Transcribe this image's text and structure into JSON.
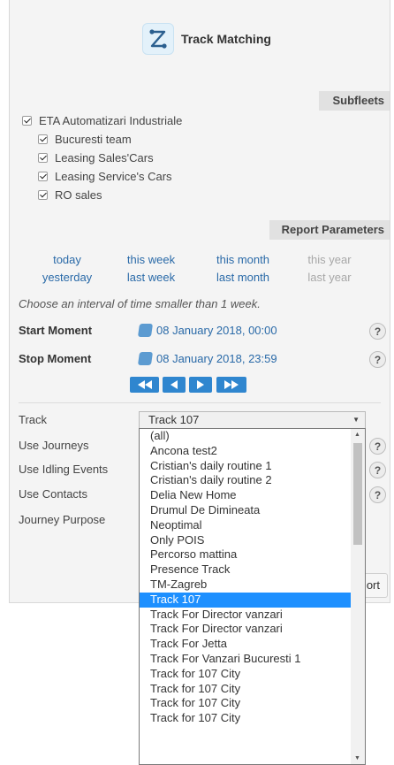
{
  "title": "Track Matching",
  "subfleets": {
    "header": "Subfleets",
    "root": "ETA Automatizari Industriale",
    "children": [
      "Bucuresti team",
      "Leasing Sales'Cars",
      "Leasing Service's Cars",
      "RO sales"
    ]
  },
  "report_parameters": {
    "header": "Report Parameters",
    "periods_row1": [
      "today",
      "this week",
      "this month",
      "this year"
    ],
    "periods_row2": [
      "yesterday",
      "last week",
      "last month",
      "last year"
    ],
    "hint": "Choose an interval of time smaller than 1 week.",
    "start_label": "Start Moment",
    "start_value": "08 January 2018, 00:00",
    "stop_label": "Stop Moment",
    "stop_value": "08 January 2018, 23:59",
    "help": "?"
  },
  "options": {
    "track_label": "Track",
    "track_value": "Track 107",
    "use_journeys": "Use Journeys",
    "use_idling": "Use Idling Events",
    "use_contacts": "Use Contacts",
    "journey_purpose": "Journey Purpose"
  },
  "report_button": "ort",
  "dropdown": {
    "selected": "Track 107",
    "items": [
      "(all)",
      "Ancona test2",
      "Cristian's daily routine 1",
      "Cristian's daily routine 2",
      "Delia New Home",
      "Drumul De Dimineata",
      "Neoptimal",
      "Only POIS",
      "Percorso mattina",
      "Presence Track",
      "TM-Zagreb",
      "Track 107",
      "Track For Director vanzari",
      "Track For Director vanzari",
      "Track For Jetta",
      "Track For Vanzari Bucuresti 1",
      "Track for 107 City",
      "Track for 107 City",
      "Track for 107 City",
      "Track for 107 City"
    ]
  },
  "colors": {
    "accent": "#2f86cf",
    "link": "#2a6aa8",
    "selected": "#1e90ff"
  }
}
